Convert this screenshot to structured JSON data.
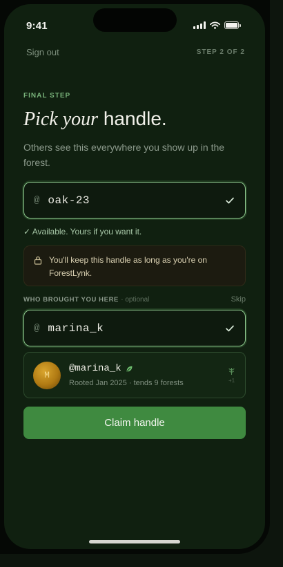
{
  "status": {
    "time": "9:41"
  },
  "header": {
    "sign_out": "Sign out",
    "step": "STEP 2 OF 2"
  },
  "eyebrow": "FINAL STEP",
  "title": {
    "italic": "Pick your",
    "rest": "handle."
  },
  "subtitle": "Others see this everywhere you show up in the forest.",
  "handle_field": {
    "prefix": "@",
    "value": "oak-23",
    "status_icon": "check-icon"
  },
  "availability": "✓ Available. Yours if you want it.",
  "notice": {
    "icon": "lock-icon",
    "text": "You'll keep this handle as long as you're on ForestLynk."
  },
  "referral": {
    "label": "WHO BROUGHT YOU HERE",
    "optional": "· optional",
    "skip": "Skip",
    "field": {
      "prefix": "@",
      "value": "marina_k",
      "status_icon": "check-icon"
    },
    "profile": {
      "avatar_initial": "M",
      "handle": "@marina_k",
      "badge_icon": "leaf-icon",
      "meta": "Rooted Jan 2025 · tends 9 forests",
      "sprout_icon": "sprout-icon",
      "plus": "+1"
    }
  },
  "cta": {
    "label": "Claim handle"
  },
  "colors": {
    "accent": "#3f8a40",
    "background": "#102010",
    "success": "#8fc98f"
  }
}
